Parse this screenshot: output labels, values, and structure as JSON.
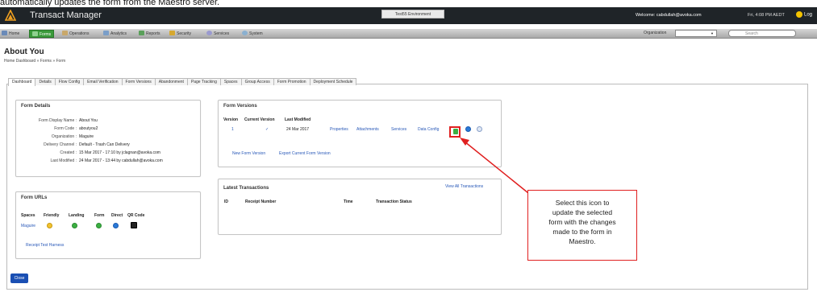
{
  "caption": "automatically updates the form from the Maestro server.",
  "titlebar": {
    "app_title": "Transact Manager",
    "environment": "Test55 Environment",
    "welcome": "Welcome: cabdullah@avoka.com",
    "timestamp": "Fri, 4:08 PM AEDT",
    "logout": "Log"
  },
  "menu": {
    "items": [
      "Home",
      "Forms",
      "Operations",
      "Analytics",
      "Reports",
      "Security",
      "Services",
      "System"
    ],
    "organization_label": "Organization",
    "search_placeholder": "Search"
  },
  "page": {
    "title": "About You",
    "breadcrumb": [
      "Home Dashboard",
      "Forms",
      "Form"
    ],
    "breadcrumb_sep": "»"
  },
  "tabs": [
    "Dashboard",
    "Details",
    "Flow Config",
    "Email Verification",
    "Form Versions",
    "Abandonment",
    "Page Tracking",
    "Spaces",
    "Group Access",
    "Form Promotion",
    "Deployment Schedule"
  ],
  "form_details": {
    "title": "Form Details",
    "rows": [
      {
        "k": "Form Display Name :",
        "v": "About You",
        "link": true
      },
      {
        "k": "Form Code :",
        "v": "aboutyou2",
        "link": false
      },
      {
        "k": "Organization :",
        "v": "Maguire",
        "link": true
      },
      {
        "k": "Delivery Channel :",
        "v": "Default - ",
        "v2": "Trash Can Delivery",
        "link": false
      },
      {
        "k": "Created :",
        "v": "15 Mar 2017 - 17:10 by jclagnan@avoka.com",
        "link": false
      },
      {
        "k": "Last Modified :",
        "v": "24 Mar 2017 - 13:44 by cabdullah@avoka.com",
        "link": false
      }
    ]
  },
  "form_urls": {
    "title": "Form URLs",
    "headers": [
      "Spaces",
      "Friendly",
      "Landing",
      "Form",
      "Direct",
      "QR Code"
    ],
    "space": "Maguire",
    "receipt_link": "Receipt Test Harness"
  },
  "form_versions": {
    "title": "Form Versions",
    "headers": [
      "Version",
      "Current Version",
      "Last Modified"
    ],
    "row": {
      "version": "1",
      "current": "✓",
      "modified": "24 Mar 2017",
      "links": [
        "Properties",
        "Attachments",
        "Services",
        "Data Config"
      ]
    },
    "new_version": "New Form Version",
    "export_version": "Export Current Form Version"
  },
  "latest_transactions": {
    "title": "Latest Transactions",
    "view_all": "View All Transactions",
    "headers": [
      "ID",
      "Receipt Number",
      "Time",
      "Transaction Status"
    ]
  },
  "callout": {
    "lines": [
      "Select this icon to",
      "update the selected",
      "form with the changes",
      "made to the form in",
      "Maestro."
    ]
  },
  "close_label": "Close",
  "colors": {
    "annotation": "#e02020",
    "link": "#2858b8",
    "titlebar": "#1f2428",
    "active_menu": "#3a9a3a"
  }
}
